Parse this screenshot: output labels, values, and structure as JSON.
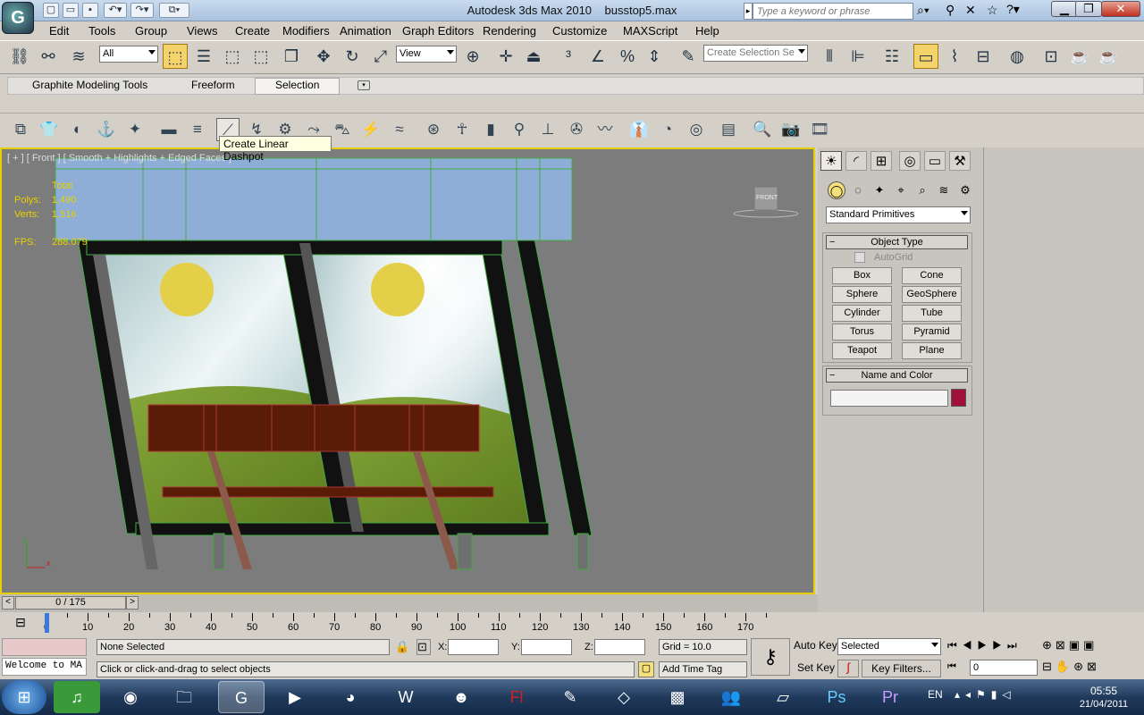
{
  "window": {
    "title": "Autodesk 3ds Max 2010",
    "file": "busstop5.max",
    "search_placeholder": "Type a keyword or phrase"
  },
  "menu": [
    "Edit",
    "Tools",
    "Group",
    "Views",
    "Create",
    "Modifiers",
    "Animation",
    "Graph Editors",
    "Rendering",
    "Customize",
    "MAXScript",
    "Help"
  ],
  "toolbar": {
    "filter": "All",
    "refcoord": "View",
    "selection_set": "Create Selection Se"
  },
  "ribbon": {
    "tabs": [
      "Graphite Modeling Tools",
      "Freeform",
      "Selection"
    ],
    "active": "Selection"
  },
  "tooltip": "Create Linear Dashpot",
  "viewport": {
    "label": "[ + ] [ Front ] [ Smooth + Highlights + Edged Faces ]",
    "stats": {
      "total_label": "Total",
      "polys_label": "Polys:",
      "polys": "1,490",
      "verts_label": "Verts:",
      "verts": "1,516",
      "fps_label": "FPS:",
      "fps": "288.079"
    },
    "viewcube": "FRONT",
    "axis_z": "z",
    "axis_x": "x"
  },
  "command_panel": {
    "category": "Standard Primitives",
    "object_type_title": "Object Type",
    "autogrid": "AutoGrid",
    "buttons": [
      "Box",
      "Cone",
      "Sphere",
      "GeoSphere",
      "Cylinder",
      "Tube",
      "Torus",
      "Pyramid",
      "Teapot",
      "Plane"
    ],
    "name_color_title": "Name and Color",
    "name_value": "",
    "color": "#a0103a"
  },
  "timeline": {
    "slider": "0 / 175",
    "prev": "<",
    "next": ">",
    "ticks": [
      "0",
      "10",
      "20",
      "30",
      "40",
      "50",
      "60",
      "70",
      "80",
      "90",
      "100",
      "110",
      "120",
      "130",
      "140",
      "150",
      "160",
      "170"
    ]
  },
  "status": {
    "maxscript": "Welcome to MA",
    "selection": "None Selected",
    "prompt": "Click or click-and-drag to select objects",
    "x_label": "X:",
    "y_label": "Y:",
    "z_label": "Z:",
    "grid": "Grid = 10.0",
    "add_time_tag": "Add Time Tag",
    "auto_key": "Auto Key",
    "set_key": "Set Key",
    "key_mode": "Selected",
    "key_filters": "Key Filters...",
    "frame": "0"
  },
  "taskbar": {
    "lang": "EN",
    "time": "05:55",
    "date": "21/04/2011"
  }
}
